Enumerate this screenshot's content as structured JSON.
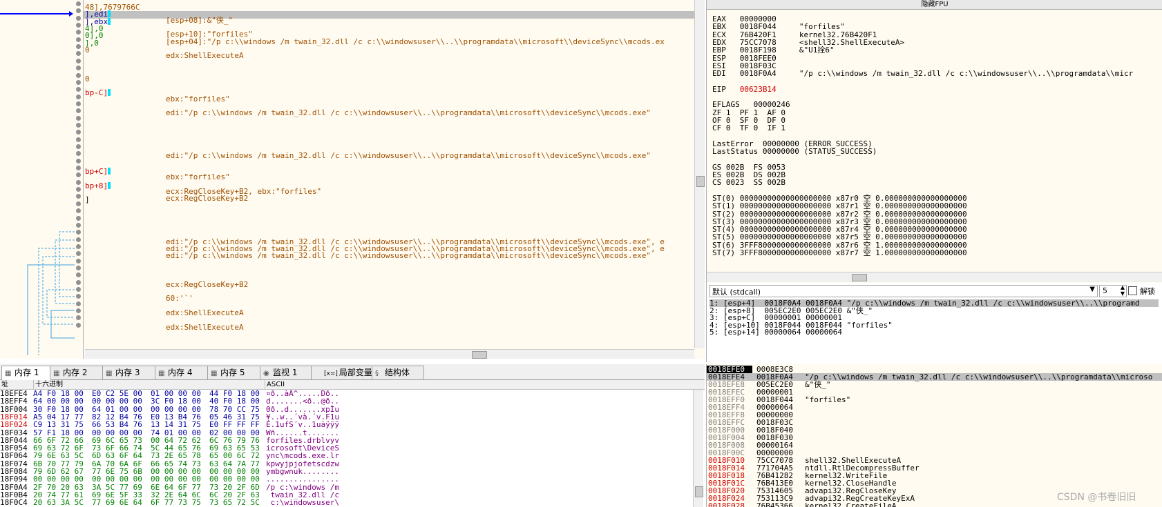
{
  "disasm": {
    "left_lines": [
      {
        "t": "48],7679766C",
        "c": "orange"
      },
      {
        "t": "],edi",
        "c": "blue",
        "hl": true
      },
      {
        "t": "],ebx",
        "c": "blue"
      },
      {
        "t": "4],0",
        "c": "green"
      },
      {
        "t": "0],0",
        "c": "green"
      },
      {
        "t": "],0",
        "c": "green"
      },
      {
        "t": "0",
        "c": "orange"
      },
      {
        "t": "",
        "c": ""
      },
      {
        "t": "",
        "c": ""
      },
      {
        "t": "",
        "c": ""
      },
      {
        "t": "0",
        "c": "orange"
      },
      {
        "t": "",
        "c": ""
      },
      {
        "t": "bp-C]",
        "c": "red"
      },
      {
        "t": "",
        "c": ""
      },
      {
        "t": "",
        "c": ""
      },
      {
        "t": "",
        "c": ""
      },
      {
        "t": "",
        "c": ""
      },
      {
        "t": "",
        "c": ""
      },
      {
        "t": "",
        "c": ""
      },
      {
        "t": "",
        "c": ""
      },
      {
        "t": "",
        "c": ""
      },
      {
        "t": "",
        "c": ""
      },
      {
        "t": "",
        "c": ""
      },
      {
        "t": "bp+C]",
        "c": "red"
      },
      {
        "t": "",
        "c": ""
      },
      {
        "t": "bp+8]",
        "c": "red"
      },
      {
        "t": "",
        "c": ""
      },
      {
        "t": "]",
        "c": ""
      }
    ],
    "comment_lines": [
      {
        "row": 2,
        "t": "[esp+08]:&\"侠_\""
      },
      {
        "row": 4,
        "t": "[esp+10]:\"forfiles\""
      },
      {
        "row": 5,
        "t": "[esp+04]:\"/p c:\\\\windows /m twain_32.dll /c c:\\\\windowsuser\\\\..\\\\programdata\\\\microsoft\\\\deviceSync\\\\mcods.ex"
      },
      {
        "row": 7,
        "t": "edx:ShellExecuteA"
      },
      {
        "row": 13,
        "t": "ebx:\"forfiles\""
      },
      {
        "row": 15,
        "t": "edi:\"/p c:\\\\windows /m twain_32.dll /c c:\\\\windowsuser\\\\..\\\\programdata\\\\microsoft\\\\deviceSync\\\\mcods.exe\""
      },
      {
        "row": 21,
        "t": "edi:\"/p c:\\\\windows /m twain_32.dll /c c:\\\\windowsuser\\\\..\\\\programdata\\\\microsoft\\\\deviceSync\\\\mcods.exe\""
      },
      {
        "row": 24,
        "t": "ebx:\"forfiles\""
      },
      {
        "row": 26,
        "t": "ecx:RegCloseKey+B2, ebx:\"forfiles\""
      },
      {
        "row": 27,
        "t": "ecx:RegCloseKey+B2"
      },
      {
        "row": 33,
        "t": "edi:\"/p c:\\\\windows /m twain_32.dll /c c:\\\\windowsuser\\\\..\\\\programdata\\\\microsoft\\\\deviceSync\\\\mcods.exe\", e"
      },
      {
        "row": 34,
        "t": "edi:\"/p c:\\\\windows /m twain_32.dll /c c:\\\\windowsuser\\\\..\\\\programdata\\\\microsoft\\\\deviceSync\\\\mcods.exe\", e"
      },
      {
        "row": 35,
        "t": "edi:\"/p c:\\\\windows /m twain_32.dll /c c:\\\\windowsuser\\\\..\\\\programdata\\\\microsoft\\\\deviceSync\\\\mcods.exe\""
      },
      {
        "row": 39,
        "t": "ecx:RegCloseKey+B2"
      },
      {
        "row": 41,
        "t": "60:'`'"
      },
      {
        "row": 43,
        "t": "edx:ShellExecuteA"
      },
      {
        "row": 45,
        "t": "edx:ShellExecuteA"
      }
    ]
  },
  "registers": {
    "header": "隐藏FPU",
    "lines": [
      {
        "t": "EAX   00000000",
        "c": ""
      },
      {
        "t": "EBX   0018F044     \"forfiles\"",
        "c": ""
      },
      {
        "t": "ECX   76B420F1     kernel32.76B420F1",
        "c": ""
      },
      {
        "t": "EDX   75CC7078     <shell32.ShellExecuteA>",
        "c": ""
      },
      {
        "t": "EBP   0018F198     &\"U1拴6\"",
        "c": ""
      },
      {
        "t": "ESP   0018FEE0",
        "c": ""
      },
      {
        "t": "ESI   0018F03C",
        "c": ""
      },
      {
        "t": "EDI   0018F0A4     \"/p c:\\\\windows /m twain_32.dll /c c:\\\\windowsuser\\\\..\\\\programdata\\\\micr",
        "c": ""
      },
      {
        "t": "",
        "c": ""
      },
      {
        "t": "EIP   00623B14",
        "c": "eip"
      },
      {
        "t": "",
        "c": ""
      },
      {
        "t": "EFLAGS   00000246",
        "c": ""
      },
      {
        "t": "ZF 1  PF 1  AF 0",
        "c": ""
      },
      {
        "t": "OF 0  SF 0  DF 0",
        "c": ""
      },
      {
        "t": "CF 0  TF 0  IF 1",
        "c": ""
      },
      {
        "t": "",
        "c": ""
      },
      {
        "t": "LastError  00000000 (ERROR_SUCCESS)",
        "c": ""
      },
      {
        "t": "LastStatus 00000000 (STATUS_SUCCESS)",
        "c": ""
      },
      {
        "t": "",
        "c": ""
      },
      {
        "t": "GS 002B  FS 0053",
        "c": ""
      },
      {
        "t": "ES 002B  DS 002B",
        "c": ""
      },
      {
        "t": "CS 0023  SS 002B",
        "c": ""
      },
      {
        "t": "",
        "c": ""
      },
      {
        "t": "ST(0) 00000000000000000000 x87r0 空 0.000000000000000000",
        "c": ""
      },
      {
        "t": "ST(1) 00000000000000000000 x87r1 空 0.000000000000000000",
        "c": ""
      },
      {
        "t": "ST(2) 00000000000000000000 x87r2 空 0.000000000000000000",
        "c": ""
      },
      {
        "t": "ST(3) 00000000000000000000 x87r3 空 0.000000000000000000",
        "c": ""
      },
      {
        "t": "ST(4) 00000000000000000000 x87r4 空 0.000000000000000000",
        "c": ""
      },
      {
        "t": "ST(5) 00000000000000000000 x87r5 空 0.000000000000000000",
        "c": ""
      },
      {
        "t": "ST(6) 3FFF8000000000000000 x87r6 空 1.000000000000000000",
        "c": ""
      },
      {
        "t": "ST(7) 3FFF8000000000000000 x87r7 空 1.000000000000000000",
        "c": ""
      }
    ]
  },
  "callpanel": {
    "convention": "默认 (stdcall)",
    "argcount": "5",
    "unlock_label": "解锁",
    "args": [
      "1: [esp+4]  0018F0A4 0018F0A4 \"/p c:\\\\windows /m twain_32.dll /c c:\\\\windowsuser\\\\..\\\\programd",
      "2: [esp+8]  005EC2E0 005EC2E0 &\"侠_\"",
      "3: [esp+C]  00000001 00000001",
      "4: [esp+10] 0018F044 0018F044 \"forfiles\"",
      "5: [esp+14] 00000064 00000064"
    ]
  },
  "tabs": [
    {
      "label": "内存 1",
      "icon": "memory-icon",
      "active": true
    },
    {
      "label": "内存 2",
      "icon": "memory-icon"
    },
    {
      "label": "内存 3",
      "icon": "memory-icon"
    },
    {
      "label": "内存 4",
      "icon": "memory-icon"
    },
    {
      "label": "内存 5",
      "icon": "memory-icon"
    },
    {
      "label": "监视 1",
      "icon": "watch-icon"
    },
    {
      "label": "局部变量",
      "icon": "locals-icon",
      "prefix": "[x=]"
    },
    {
      "label": "结构体",
      "icon": "struct-icon"
    }
  ],
  "dump": {
    "headers": {
      "addr": "址",
      "hex": "十六进制",
      "ascii": "ASCII"
    },
    "rows": [
      {
        "addr": "18EFE4",
        "h": [
          "A4 F0 18 00",
          "E0 C2 5E 00",
          "01 00 00 00",
          "44 F0 18 00"
        ],
        "a": "¤ð..àÂ^.....Dð..",
        "red": false
      },
      {
        "addr": "18EFF4",
        "h": [
          "64 00 00 00",
          "00 00 00 00",
          "3C F0 18 00",
          "40 F0 18 00"
        ],
        "a": "d.......<ð..@ð..",
        "red": false
      },
      {
        "addr": "18F004",
        "h": [
          "30 F0 18 00",
          "64 01 00 00",
          "00 00 00 00",
          "78 70 CC 75"
        ],
        "a": "0ð..d.......xpÌu",
        "red": false
      },
      {
        "addr": "18F014",
        "h": [
          "A5 04 17 77",
          "82 12 B4 76",
          "E0 13 B4 76",
          "05 46 31 75"
        ],
        "a": "¥..w..´và.´v.F1u",
        "red": true
      },
      {
        "addr": "18F024",
        "h": [
          "C9 13 31 75",
          "66 53 B4 76",
          "13 14 31 75",
          "E0 FF FF FF"
        ],
        "a": "É.1ufS´v..1uàÿÿÿ",
        "red": true
      },
      {
        "addr": "18F034",
        "h": [
          "57 F1 18 00",
          "00 00 00 00",
          "74 01 00 00",
          "02 00 00 00"
        ],
        "a": "Wñ......t.......",
        "red": false
      },
      {
        "addr": "18F044",
        "h": [
          "66 6F 72 66",
          "69 6C 65 73",
          "00 64 72 62",
          "6C 76 79 76"
        ],
        "a": "forfiles.drblvyv",
        "red": false
      },
      {
        "addr": "18F054",
        "h": [
          "69 63 72 6F",
          "73 6F 66 74",
          "5C 44 65 76",
          "69 63 65 53"
        ],
        "a": "icrosoft\\DeviceS",
        "red": false
      },
      {
        "addr": "18F064",
        "h": [
          "79 6E 63 5C",
          "6D 63 6F 64",
          "73 2E 65 78",
          "65 00 6C 72"
        ],
        "a": "ync\\mcods.exe.lr",
        "red": false
      },
      {
        "addr": "18F074",
        "h": [
          "6B 70 77 79",
          "6A 70 6A 6F",
          "66 65 74 73",
          "63 64 7A 77"
        ],
        "a": "kpwyjpjofetscdzw",
        "red": false
      },
      {
        "addr": "18F084",
        "h": [
          "79 6D 62 67",
          "77 6E 75 6B",
          "00 00 00 00",
          "00 00 00 00"
        ],
        "a": "ymbgwnuk........",
        "red": false
      },
      {
        "addr": "18F094",
        "h": [
          "00 00 00 00",
          "00 00 00 00",
          "00 00 00 00",
          "00 00 00 00"
        ],
        "a": "................",
        "red": false
      },
      {
        "addr": "18F0A4",
        "h": [
          "2F 70 20 63",
          "3A 5C 77 69",
          "6E 64 6F 77",
          "73 20 2F 6D"
        ],
        "a": "/p c:\\windows /m",
        "red": false
      },
      {
        "addr": "18F0B4",
        "h": [
          "20 74 77 61",
          "69 6E 5F 33",
          "32 2E 64 6C",
          "6C 20 2F 63"
        ],
        "a": " twain_32.dll /c",
        "red": false
      },
      {
        "addr": "18F0C4",
        "h": [
          "20 63 3A 5C",
          "77 69 6E 64",
          "6F 77 73 75",
          "73 65 72 5C"
        ],
        "a": " c:\\windowsuser\\",
        "red": false
      }
    ]
  },
  "stack": {
    "rows": [
      {
        "addr": "0018EFE0",
        "val": "0008E3C8",
        "cmt": "",
        "sel": true
      },
      {
        "addr": "0018EFE4",
        "val": "0018F0A4",
        "cmt": "\"/p c:\\\\windows /m twain_32.dll /c c:\\\\windowsuser\\\\..\\\\programdata\\\\microso",
        "hl": true
      },
      {
        "addr": "0018EFE8",
        "val": "005EC2E0",
        "cmt": "&\"侠_\""
      },
      {
        "addr": "0018EFEC",
        "val": "00000001",
        "cmt": ""
      },
      {
        "addr": "0018EFF0",
        "val": "0018F044",
        "cmt": "\"forfiles\""
      },
      {
        "addr": "0018EFF4",
        "val": "00000064",
        "cmt": ""
      },
      {
        "addr": "0018EFF8",
        "val": "00000000",
        "cmt": ""
      },
      {
        "addr": "0018EFFC",
        "val": "0018F03C",
        "cmt": ""
      },
      {
        "addr": "0018F000",
        "val": "0018F040",
        "cmt": ""
      },
      {
        "addr": "0018F004",
        "val": "0018F030",
        "cmt": ""
      },
      {
        "addr": "0018F008",
        "val": "00000164",
        "cmt": ""
      },
      {
        "addr": "0018F00C",
        "val": "00000000",
        "cmt": ""
      },
      {
        "addr": "0018F010",
        "val": "75CC7078",
        "cmt": "shell32.ShellExecuteA",
        "red": true
      },
      {
        "addr": "0018F014",
        "val": "771704A5",
        "cmt": "ntdll.RtlDecompressBuffer",
        "red": true
      },
      {
        "addr": "0018F018",
        "val": "76B41282",
        "cmt": "kernel32.WriteFile",
        "red": true
      },
      {
        "addr": "0018F01C",
        "val": "76B413E0",
        "cmt": "kernel32.CloseHandle",
        "red": true
      },
      {
        "addr": "0018F020",
        "val": "75314605",
        "cmt": "advapi32.RegCloseKey",
        "red": true
      },
      {
        "addr": "0018F024",
        "val": "753113C9",
        "cmt": "advapi32.RegCreateKeyExA",
        "red": true
      },
      {
        "addr": "0018F028",
        "val": "76B45366",
        "cmt": "kernel32.CreateFileA",
        "red": true
      }
    ]
  },
  "watermark": "CSDN @书卷旧旧"
}
